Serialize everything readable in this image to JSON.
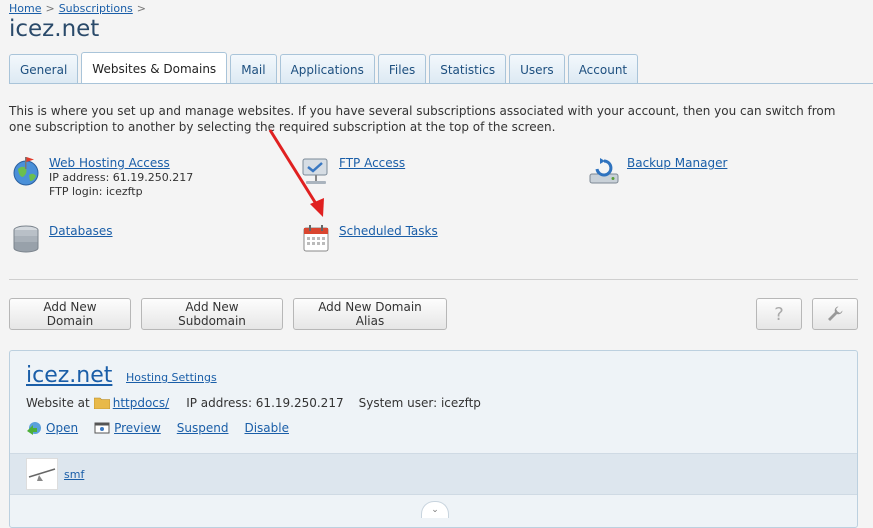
{
  "breadcrumb": {
    "home": "Home",
    "subscriptions": "Subscriptions",
    "separator": ">"
  },
  "page": {
    "title": "icez.net"
  },
  "tabs": [
    {
      "label": "General"
    },
    {
      "label": "Websites & Domains",
      "active": true
    },
    {
      "label": "Mail"
    },
    {
      "label": "Applications"
    },
    {
      "label": "Files"
    },
    {
      "label": "Statistics"
    },
    {
      "label": "Users"
    },
    {
      "label": "Account"
    }
  ],
  "intro": "This is where you set up and manage websites. If you have several subscriptions associated with your account, then you can switch from one subscription to another by selecting the required subscription at the top of the screen.",
  "tools": {
    "web_hosting": {
      "label": "Web Hosting Access",
      "ip": "IP address: 61.19.250.217",
      "ftp": "FTP login: icezftp",
      "icon": "globe-icon"
    },
    "ftp": {
      "label": "FTP Access",
      "icon": "ftp-icon"
    },
    "backup": {
      "label": "Backup Manager",
      "icon": "backup-icon"
    },
    "databases": {
      "label": "Databases",
      "icon": "database-icon"
    },
    "scheduled": {
      "label": "Scheduled Tasks",
      "icon": "calendar-icon"
    }
  },
  "buttons": {
    "add_domain": "Add New Domain",
    "add_subdomain": "Add New Subdomain",
    "add_alias": "Add New Domain Alias",
    "help": "?"
  },
  "domain": {
    "name": "icez.net",
    "hosting_settings": "Hosting Settings",
    "website_at": "Website at",
    "folder": "httpdocs/",
    "ip": "IP address: 61.19.250.217",
    "system_user": "System user: icezftp",
    "actions": {
      "open": "Open",
      "preview": "Preview",
      "suspend": "Suspend",
      "disable": "Disable"
    },
    "app": "smf"
  },
  "colors": {
    "link": "#1a5ea8",
    "tab_border": "#a9c4d9",
    "arrow": "#e02020"
  }
}
